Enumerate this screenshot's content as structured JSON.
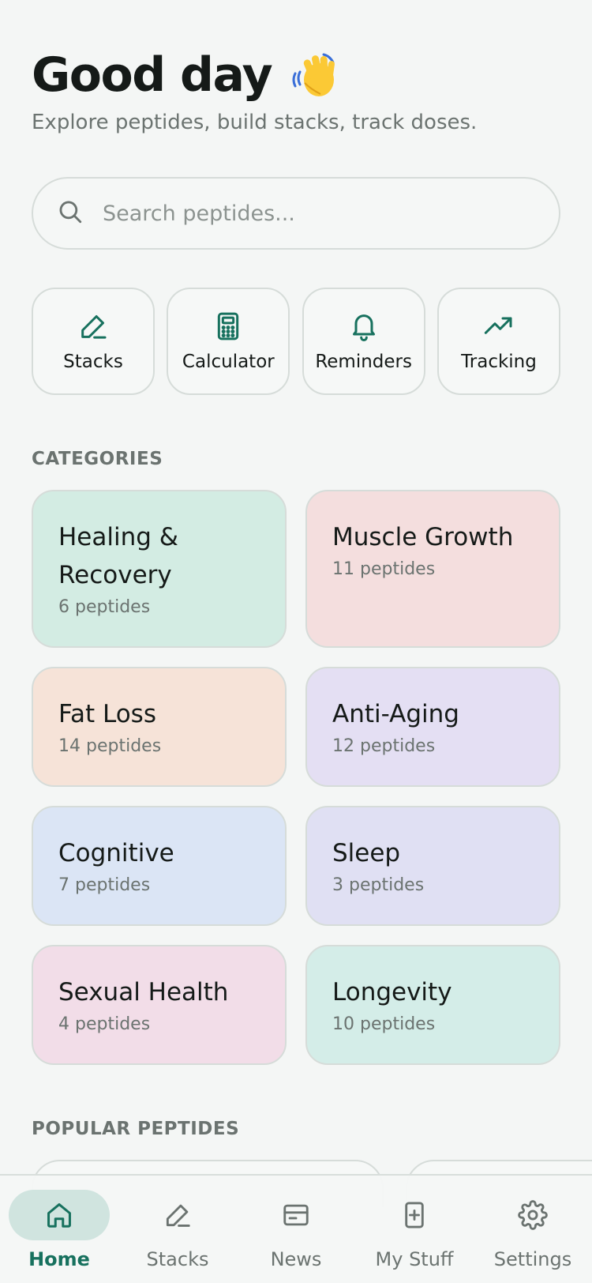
{
  "header": {
    "greeting": "Good day",
    "subtitle": "Explore peptides, build stacks, track doses."
  },
  "search": {
    "placeholder": "Search peptides...",
    "value": ""
  },
  "quick_actions": [
    {
      "label": "Stacks",
      "icon": "pencil-icon"
    },
    {
      "label": "Calculator",
      "icon": "calculator-icon"
    },
    {
      "label": "Reminders",
      "icon": "bell-icon"
    },
    {
      "label": "Tracking",
      "icon": "trending-up-icon"
    }
  ],
  "categories": {
    "heading": "CATEGORIES",
    "items": [
      {
        "name": "Healing & Recovery",
        "count": "6 peptides",
        "color": "#d3ece3"
      },
      {
        "name": "Muscle Growth",
        "count": "11 peptides",
        "color": "#f4dede"
      },
      {
        "name": "Fat Loss",
        "count": "14 peptides",
        "color": "#f6e3d8"
      },
      {
        "name": "Anti-Aging",
        "count": "12 peptides",
        "color": "#e4dff3"
      },
      {
        "name": "Cognitive",
        "count": "7 peptides",
        "color": "#dbe5f5"
      },
      {
        "name": "Sleep",
        "count": "3 peptides",
        "color": "#e0e0f3"
      },
      {
        "name": "Sexual Health",
        "count": "4 peptides",
        "color": "#f2dde8"
      },
      {
        "name": "Longevity",
        "count": "10 peptides",
        "color": "#d4ede8"
      }
    ]
  },
  "popular": {
    "heading": "POPULAR PEPTIDES"
  },
  "tabbar": {
    "items": [
      {
        "label": "Home",
        "icon": "home-icon",
        "active": true
      },
      {
        "label": "Stacks",
        "icon": "pencil-icon"
      },
      {
        "label": "News",
        "icon": "news-icon"
      },
      {
        "label": "My Stuff",
        "icon": "add-file-icon"
      },
      {
        "label": "Settings",
        "icon": "gear-icon"
      }
    ]
  },
  "colors": {
    "accent": "#17715e",
    "background": "#f4f6f5",
    "active_tab_bg": "#d0e4df"
  }
}
